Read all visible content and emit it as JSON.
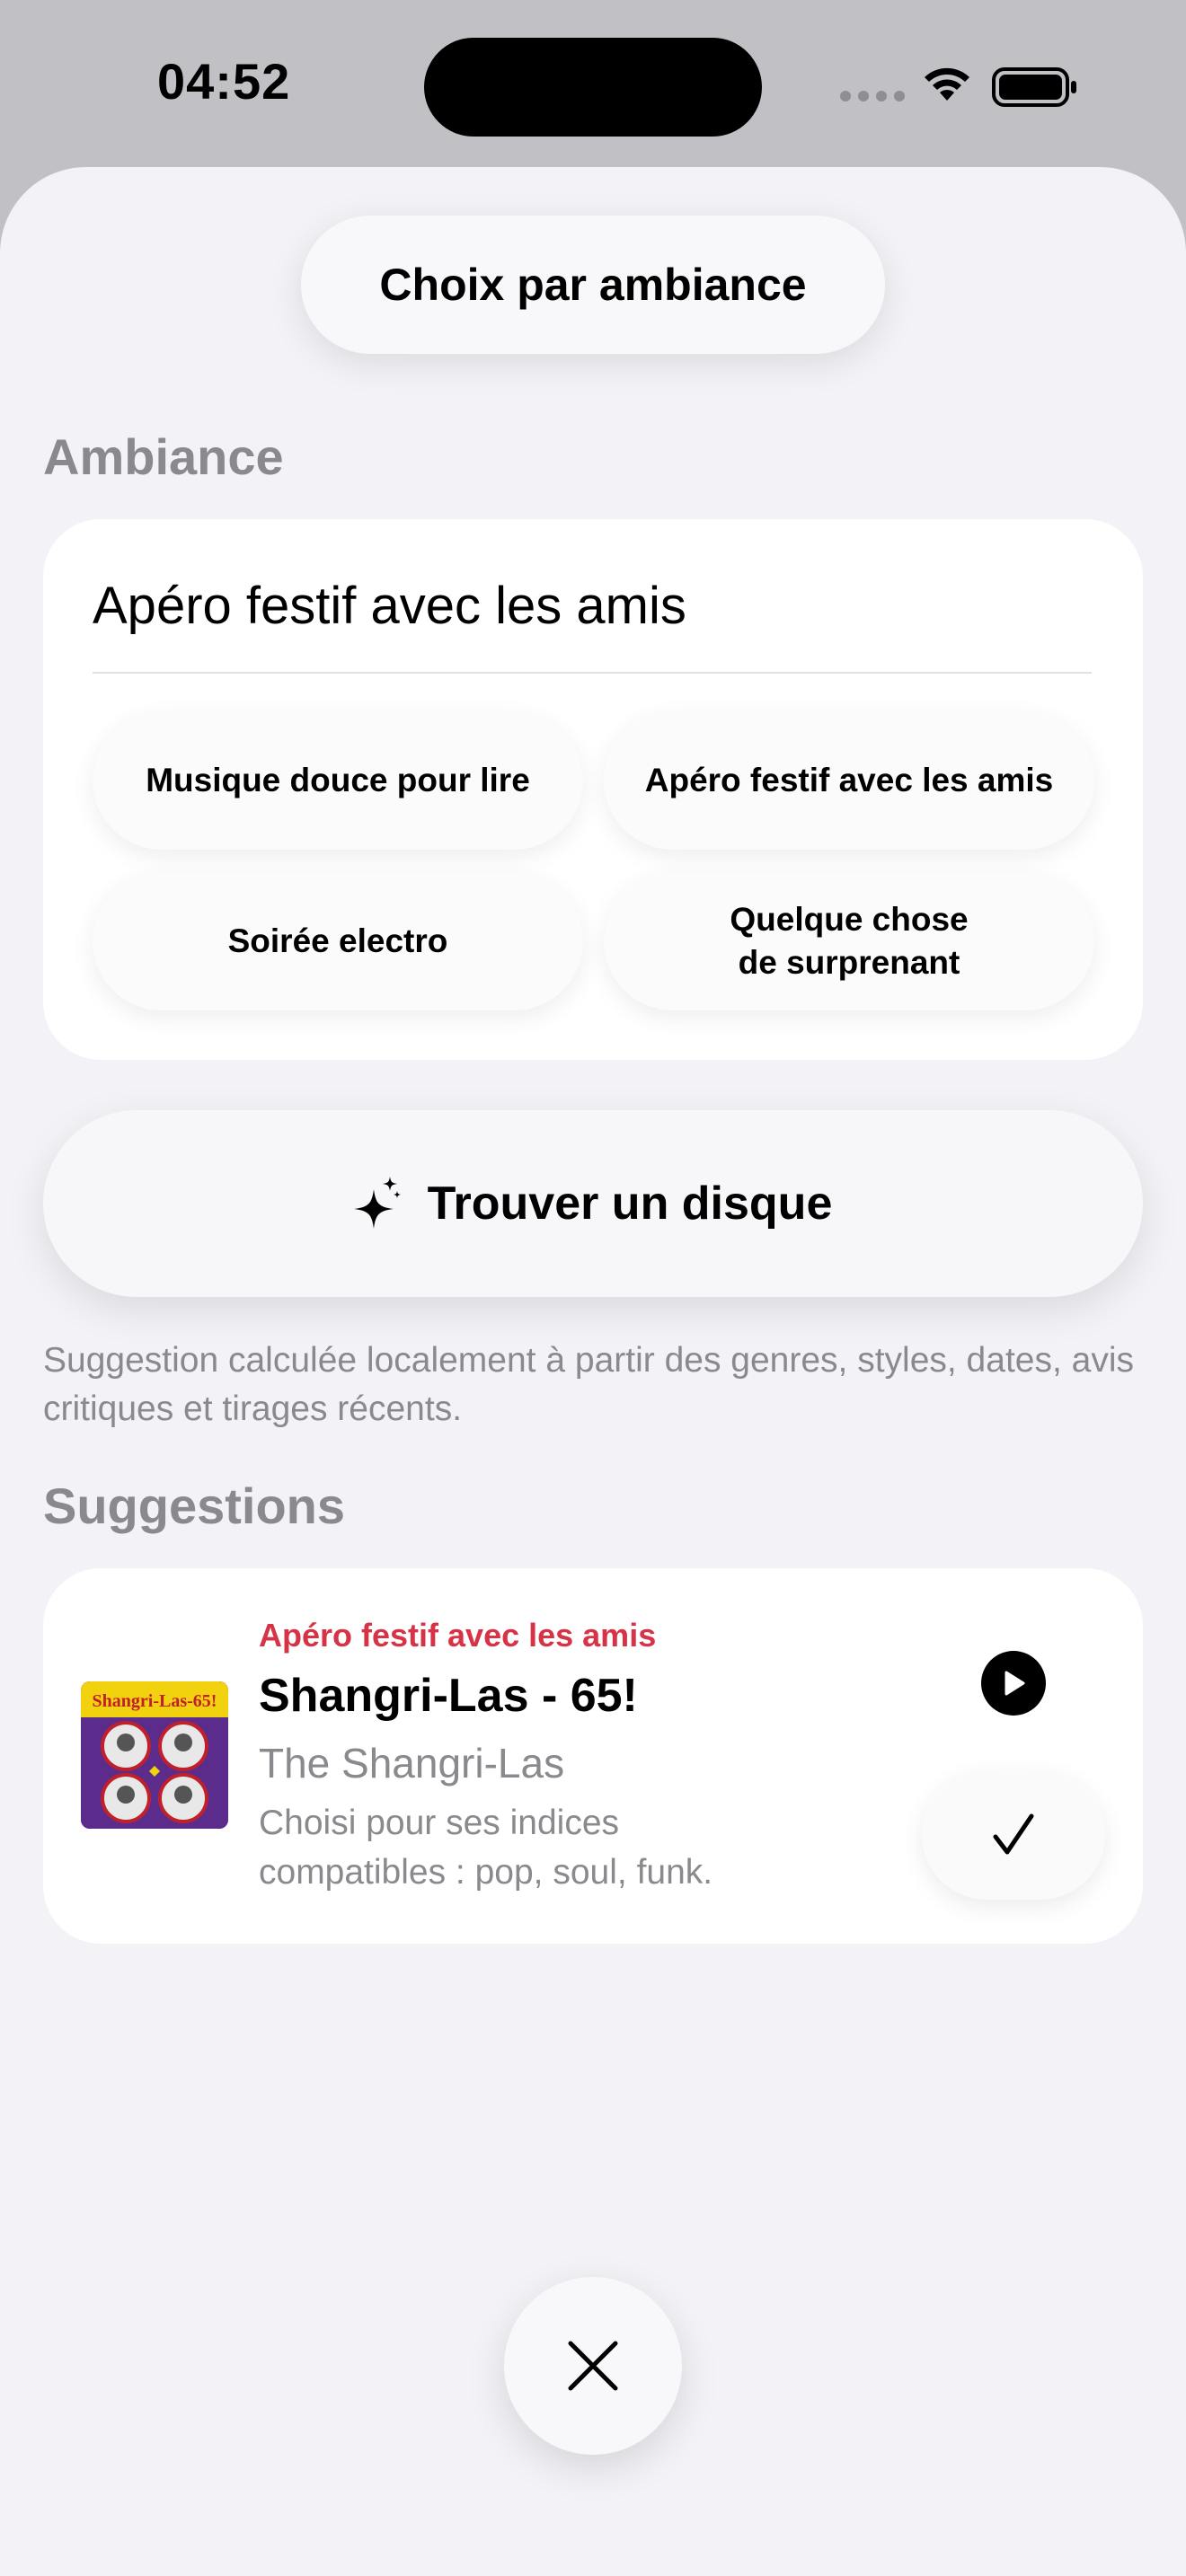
{
  "status_bar": {
    "time": "04:52"
  },
  "header": {
    "title": "Choix par ambiance"
  },
  "ambiance": {
    "section_title": "Ambiance",
    "input_value": "Apéro festif avec les amis",
    "chips": [
      "Musique douce pour lire",
      "Apéro festif avec les amis",
      "Soirée electro",
      "Quelque chose\nde surprenant"
    ]
  },
  "find_button": {
    "label": "Trouver un disque",
    "icon": "sparkles-icon"
  },
  "footnote": "Suggestion calculée localement à partir des genres, styles, dates, avis critiques et tirages récents.",
  "suggestions": {
    "section_title": "Suggestions",
    "items": [
      {
        "mood": "Apéro festif avec les amis",
        "title": "Shangri-Las - 65!",
        "artist": "The Shangri-Las",
        "reason": "Choisi pour ses indices compatibles : pop, soul, funk.",
        "cover_text": "Shangri-Las-65!"
      }
    ]
  },
  "colors": {
    "accent_red": "#d63446",
    "secondary_text": "#8a8a8e",
    "sheet_bg": "#f2f2f7"
  }
}
